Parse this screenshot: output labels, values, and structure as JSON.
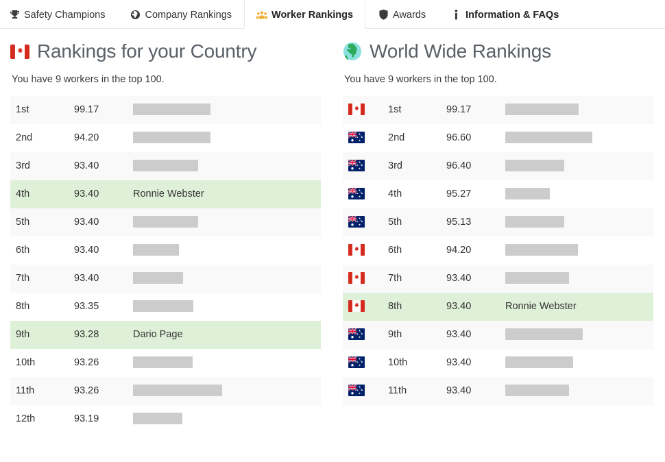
{
  "tabs": [
    {
      "label": "Safety Champions",
      "icon": "trophy-icon",
      "active": false,
      "bold": false
    },
    {
      "label": "Company Rankings",
      "icon": "globe-icon",
      "active": false,
      "bold": false
    },
    {
      "label": "Worker Rankings",
      "icon": "users-icon",
      "active": true,
      "bold": true
    },
    {
      "label": "Awards",
      "icon": "shield-icon",
      "active": false,
      "bold": false
    },
    {
      "label": "Information & FAQs",
      "icon": "info-icon",
      "active": false,
      "bold": true
    }
  ],
  "colors": {
    "highlight_row": "#dff0d8",
    "stripe_row": "#f9f9f9",
    "redaction_bar": "#cccccc",
    "active_tab_icon": "#f0ad2e",
    "panel_title": "#5a6067",
    "border": "#e7e7e7"
  },
  "country_panel": {
    "flag": "canada-flag-icon",
    "title": "Rankings for your Country",
    "subtitle": "You have 9 workers in the top 100.",
    "rows": [
      {
        "rank": "1st",
        "score": "99.17",
        "name": "",
        "redacted_width": 113,
        "highlight": false
      },
      {
        "rank": "2nd",
        "score": "94.20",
        "name": "",
        "redacted_width": 113,
        "highlight": false
      },
      {
        "rank": "3rd",
        "score": "93.40",
        "name": "",
        "redacted_width": 95,
        "highlight": false
      },
      {
        "rank": "4th",
        "score": "93.40",
        "name": "Ronnie Webster",
        "redacted_width": 0,
        "highlight": true
      },
      {
        "rank": "5th",
        "score": "93.40",
        "name": "",
        "redacted_width": 95,
        "highlight": false
      },
      {
        "rank": "6th",
        "score": "93.40",
        "name": "",
        "redacted_width": 67,
        "highlight": false
      },
      {
        "rank": "7th",
        "score": "93.40",
        "name": "",
        "redacted_width": 73,
        "highlight": false
      },
      {
        "rank": "8th",
        "score": "93.35",
        "name": "",
        "redacted_width": 88,
        "highlight": false
      },
      {
        "rank": "9th",
        "score": "93.28",
        "name": "Dario Page",
        "redacted_width": 0,
        "highlight": true
      },
      {
        "rank": "10th",
        "score": "93.26",
        "name": "",
        "redacted_width": 87,
        "highlight": false
      },
      {
        "rank": "11th",
        "score": "93.26",
        "name": "",
        "redacted_width": 130,
        "highlight": false
      },
      {
        "rank": "12th",
        "score": "93.19",
        "name": "",
        "redacted_width": 72,
        "highlight": false
      }
    ]
  },
  "world_panel": {
    "flag": "earth-globe-icon",
    "title": "World Wide Rankings",
    "subtitle": "You have 9 workers in the top 100.",
    "rows": [
      {
        "flag": "canada",
        "rank": "1st",
        "score": "99.17",
        "name": "",
        "redacted_width": 107,
        "highlight": false
      },
      {
        "flag": "australia",
        "rank": "2nd",
        "score": "96.60",
        "name": "",
        "redacted_width": 127,
        "highlight": false
      },
      {
        "flag": "australia",
        "rank": "3rd",
        "score": "96.40",
        "name": "",
        "redacted_width": 86,
        "highlight": false
      },
      {
        "flag": "australia",
        "rank": "4th",
        "score": "95.27",
        "name": "",
        "redacted_width": 65,
        "highlight": false
      },
      {
        "flag": "australia",
        "rank": "5th",
        "score": "95.13",
        "name": "",
        "redacted_width": 86,
        "highlight": false
      },
      {
        "flag": "canada",
        "rank": "6th",
        "score": "94.20",
        "name": "",
        "redacted_width": 106,
        "highlight": false
      },
      {
        "flag": "canada",
        "rank": "7th",
        "score": "93.40",
        "name": "",
        "redacted_width": 93,
        "highlight": false
      },
      {
        "flag": "canada",
        "rank": "8th",
        "score": "93.40",
        "name": "Ronnie Webster",
        "redacted_width": 0,
        "highlight": true
      },
      {
        "flag": "australia",
        "rank": "9th",
        "score": "93.40",
        "name": "",
        "redacted_width": 113,
        "highlight": false
      },
      {
        "flag": "australia",
        "rank": "10th",
        "score": "93.40",
        "name": "",
        "redacted_width": 99,
        "highlight": false
      },
      {
        "flag": "australia",
        "rank": "11th",
        "score": "93.40",
        "name": "",
        "redacted_width": 93,
        "highlight": false
      }
    ]
  }
}
